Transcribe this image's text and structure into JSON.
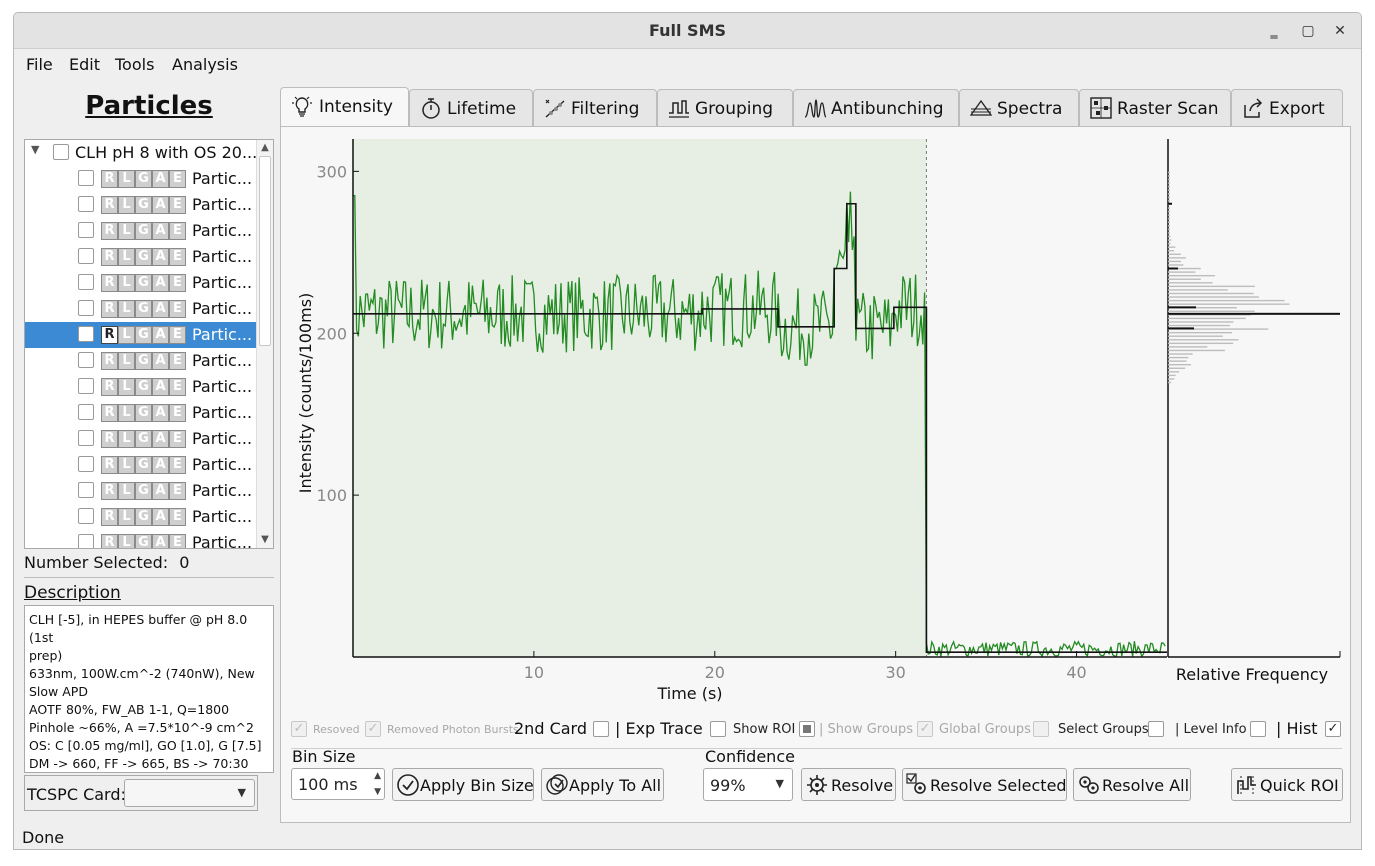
{
  "window": {
    "title": "Full SMS",
    "minimize": "‗",
    "maximize": "▢",
    "close": "✕"
  },
  "menu": [
    "File",
    "Edit",
    "Tools",
    "Analysis"
  ],
  "left_panel": {
    "title": "Particles",
    "root_label": "CLH pH 8 with OS 20...",
    "flags": [
      "R",
      "L",
      "G",
      "A",
      "E"
    ],
    "particle_label": "Partic...",
    "particle_count_visible": 15,
    "selected_index": 6,
    "number_selected_label": "Number Selected:",
    "number_selected_value": "0",
    "description_label": "Description",
    "description_lines": [
      "CLH [-5], in HEPES buffer @ pH 8.0 (1st",
      "prep)",
      "633nm, 100W.cm^-2 (740nW), New",
      "Slow APD",
      "AOTF 80%, FW_AB 1-1, Q=1800",
      "Pinhole ~66%, A =7.5*10^-9 cm^2",
      "OS: C [0.05 mg/ml], GO [1.0], G [7.5]",
      "DM -> 660, FF -> 665, BS -> 70:30"
    ],
    "tcspc_label": "TCSPC Card:",
    "tcspc_value": ""
  },
  "tabs": [
    {
      "label": "Intensity",
      "icon": "bulb-icon"
    },
    {
      "label": "Lifetime",
      "icon": "stopwatch-icon"
    },
    {
      "label": "Filtering",
      "icon": "filter-icon"
    },
    {
      "label": "Grouping",
      "icon": "grouping-icon"
    },
    {
      "label": "Antibunching",
      "icon": "antibunching-icon"
    },
    {
      "label": "Spectra",
      "icon": "spectra-icon"
    },
    {
      "label": "Raster Scan",
      "icon": "raster-icon"
    },
    {
      "label": "Export",
      "icon": "export-icon"
    }
  ],
  "active_tab": 0,
  "chart_data": {
    "type": "line",
    "xlabel": "Time (s)",
    "ylabel": "Intensity (counts/100ms)",
    "xlim": [
      0,
      45
    ],
    "ylim": [
      0,
      320
    ],
    "xticks": [
      10,
      20,
      30,
      40
    ],
    "yticks": [
      100,
      200,
      300
    ],
    "roi_end": 31.7,
    "series": [
      {
        "type": "trace",
        "color": "#228b22",
        "mean_levels": [
          [
            0,
            31.7,
            212
          ],
          [
            31.7,
            45,
            5
          ]
        ],
        "noise": 15
      },
      {
        "type": "levels",
        "color": "#111111",
        "steps": [
          [
            0,
            19.3,
            212
          ],
          [
            19.3,
            23.5,
            215
          ],
          [
            23.5,
            26.6,
            204
          ],
          [
            26.6,
            27.3,
            240
          ],
          [
            27.3,
            27.8,
            280
          ],
          [
            27.8,
            29.9,
            203
          ],
          [
            29.9,
            31.7,
            216
          ],
          [
            31.7,
            45,
            3
          ]
        ]
      }
    ],
    "histogram": {
      "label": "Relative Frequency"
    }
  },
  "options": {
    "resolved": "Resoved",
    "removed_photon_bursts": "Removed Photon Bursts",
    "second_card": "2nd Card",
    "exp_trace": "| Exp Trace",
    "show_roi": "Show ROI",
    "show_groups": "| Show Groups",
    "global_groups": "Global Groups",
    "select_groups": "Select Groups",
    "level_info": "| Level Info",
    "hist": "| Hist",
    "check": "✓"
  },
  "controls": {
    "bin_size_label": "Bin Size",
    "bin_size_value": "100 ms",
    "apply_bin_size": "Apply Bin Size",
    "apply_to_all": "Apply To All",
    "confidence_label": "Confidence",
    "confidence_value": "99%",
    "resolve": "Resolve",
    "resolve_selected": "Resolve Selected",
    "resolve_all": "Resolve All",
    "quick_roi": "Quick ROI"
  },
  "status": "Done"
}
